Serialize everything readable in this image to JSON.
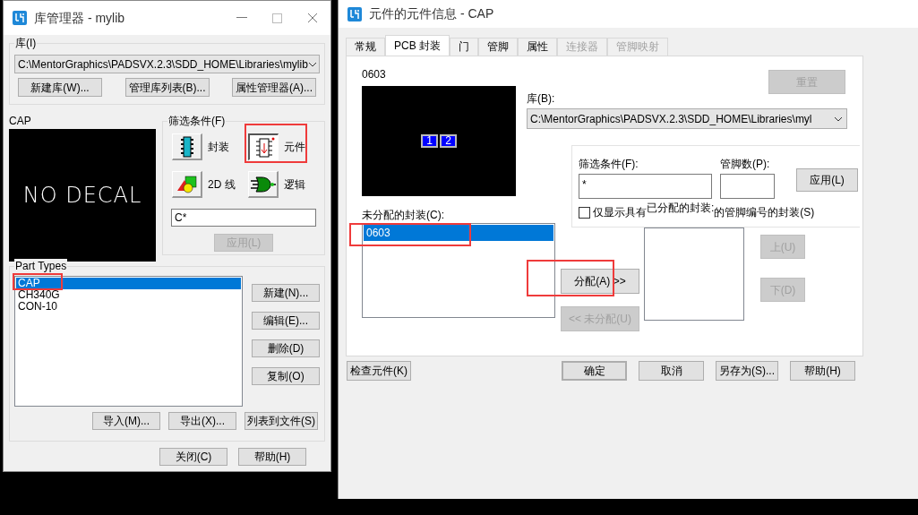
{
  "library_manager": {
    "title": "库管理器 - mylib",
    "library": {
      "label": "库(I)",
      "path": "C:\\MentorGraphics\\PADSVX.2.3\\SDD_HOME\\Libraries\\mylib",
      "buttons": [
        "新建库(W)...",
        "管理库列表(B)...",
        "属性管理器(A)..."
      ]
    },
    "preview": {
      "label": "CAP",
      "text": "NO DECAL"
    },
    "filter": {
      "label": "筛选条件(F)",
      "types": [
        {
          "kind": "decal",
          "label": "封装",
          "selected": false
        },
        {
          "kind": "part",
          "label": "元件",
          "selected": true
        },
        {
          "kind": "lines",
          "label": "2D 线",
          "selected": false
        },
        {
          "kind": "logic",
          "label": "逻辑",
          "selected": false
        }
      ],
      "value": "C*",
      "apply": {
        "label": "应用(L)",
        "disabled": true
      }
    },
    "part_types": {
      "label": "Part Types",
      "items": [
        {
          "label": "CAP",
          "selected": true
        },
        {
          "label": "CH340G",
          "selected": false
        },
        {
          "label": "CON-10",
          "selected": false
        }
      ],
      "side_buttons": [
        "新建(N)...",
        "编辑(E)...",
        "删除(D)",
        "复制(O)"
      ],
      "bottom_buttons": [
        "导入(M)...",
        "导出(X)...",
        "列表到文件(S)"
      ]
    },
    "footer_buttons": [
      "关闭(C)",
      "帮助(H)"
    ]
  },
  "part_info": {
    "title": "元件的元件信息 - CAP",
    "tabs": [
      {
        "label": "常规",
        "selected": false,
        "disabled": false
      },
      {
        "label": "PCB 封装",
        "selected": true,
        "disabled": false
      },
      {
        "label": "门",
        "selected": false,
        "disabled": false
      },
      {
        "label": "管脚",
        "selected": false,
        "disabled": false
      },
      {
        "label": "属性",
        "selected": false,
        "disabled": false
      },
      {
        "label": "连接器",
        "selected": false,
        "disabled": true
      },
      {
        "label": "管脚映射",
        "selected": false,
        "disabled": true
      }
    ],
    "decal_name": "0603",
    "pads": [
      "1",
      "2"
    ],
    "reset": {
      "label": "重置",
      "disabled": true
    },
    "library_label": "库(B):",
    "library_path": "C:\\MentorGraphics\\PADSVX.2.3\\SDD_HOME\\Libraries\\myl",
    "filter_label": "筛选条件(F):",
    "filter_value": "*",
    "pin_count_label": "管脚数(P):",
    "apply": {
      "label": "应用(L)",
      "disabled": false
    },
    "checkbox": {
      "label_start": "仅显示具有",
      "label_end": "的管脚编号的封装(S)",
      "checked": false
    },
    "unassigned_label": "未分配的封装(C):",
    "unassigned": [
      {
        "label": "0603",
        "selected": true
      }
    ],
    "assign": {
      "label": "分配(A) >>",
      "disabled": false
    },
    "unassign": {
      "label": "<< 未分配(U)",
      "disabled": true
    },
    "assigned_label": "已分配的封装:",
    "up": {
      "label": "上(U)",
      "disabled": true
    },
    "down": {
      "label": "下(D)",
      "disabled": true
    },
    "check_button": {
      "label": "检查元件(K)",
      "disabled": false
    },
    "footer_buttons": [
      {
        "label": "确定",
        "default": true
      },
      {
        "label": "取消",
        "default": false
      },
      {
        "label": "另存为(S)...",
        "default": false
      },
      {
        "label": "帮助(H)",
        "default": false
      }
    ]
  }
}
